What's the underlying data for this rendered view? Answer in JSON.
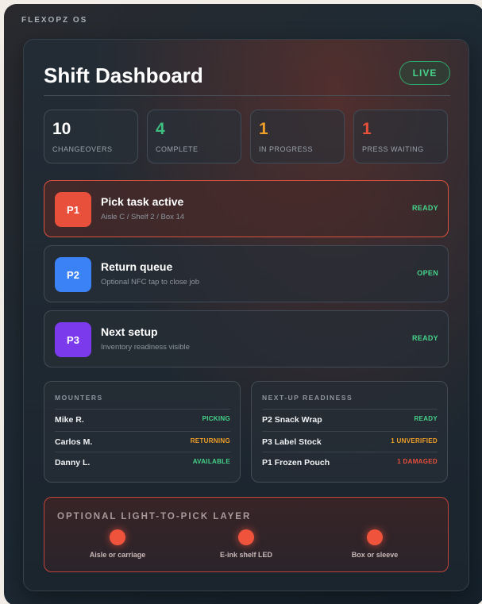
{
  "os_label": "FLEXOPZ OS",
  "title": "Shift Dashboard",
  "live_badge": "LIVE",
  "stats": [
    {
      "value": "10",
      "label": "CHANGEOVERS",
      "color": "#ffffff"
    },
    {
      "value": "4",
      "label": "COMPLETE",
      "color": "#3fbf7f"
    },
    {
      "value": "1",
      "label": "IN PROGRESS",
      "color": "#f0a028"
    },
    {
      "value": "1",
      "label": "PRESS WAITING",
      "color": "#e9503c"
    }
  ],
  "tasks": [
    {
      "badge": "P1",
      "badge_color": "#e9503c",
      "title": "Pick task active",
      "subtitle": "Aisle C / Shelf 2 / Box 14",
      "status": "READY",
      "status_color": "#46d38a"
    },
    {
      "badge": "P2",
      "badge_color": "#3b82f6",
      "title": "Return queue",
      "subtitle": "Optional NFC tap to close job",
      "status": "OPEN",
      "status_color": "#46d38a"
    },
    {
      "badge": "P3",
      "badge_color": "#7c3aed",
      "title": "Next setup",
      "subtitle": "Inventory readiness visible",
      "status": "READY",
      "status_color": "#46d38a"
    }
  ],
  "mounters": {
    "heading": "MOUNTERS",
    "rows": [
      {
        "name": "Mike R.",
        "status": "PICKING",
        "color": "#46d38a"
      },
      {
        "name": "Carlos M.",
        "status": "RETURNING",
        "color": "#f0a028"
      },
      {
        "name": "Danny L.",
        "status": "AVAILABLE",
        "color": "#46d38a"
      }
    ]
  },
  "readiness": {
    "heading": "NEXT-UP READINESS",
    "rows": [
      {
        "name": "P2 Snack Wrap",
        "status": "READY",
        "color": "#46d38a"
      },
      {
        "name": "P3 Label Stock",
        "status": "1 UNVERIFIED",
        "color": "#f0a028"
      },
      {
        "name": "P1 Frozen Pouch",
        "status": "1 DAMAGED",
        "color": "#e9503c"
      }
    ]
  },
  "light_layer": {
    "heading": "OPTIONAL LIGHT-TO-PICK LAYER",
    "points": [
      "Aisle or carriage",
      "E-ink shelf LED",
      "Box or sleeve"
    ]
  }
}
